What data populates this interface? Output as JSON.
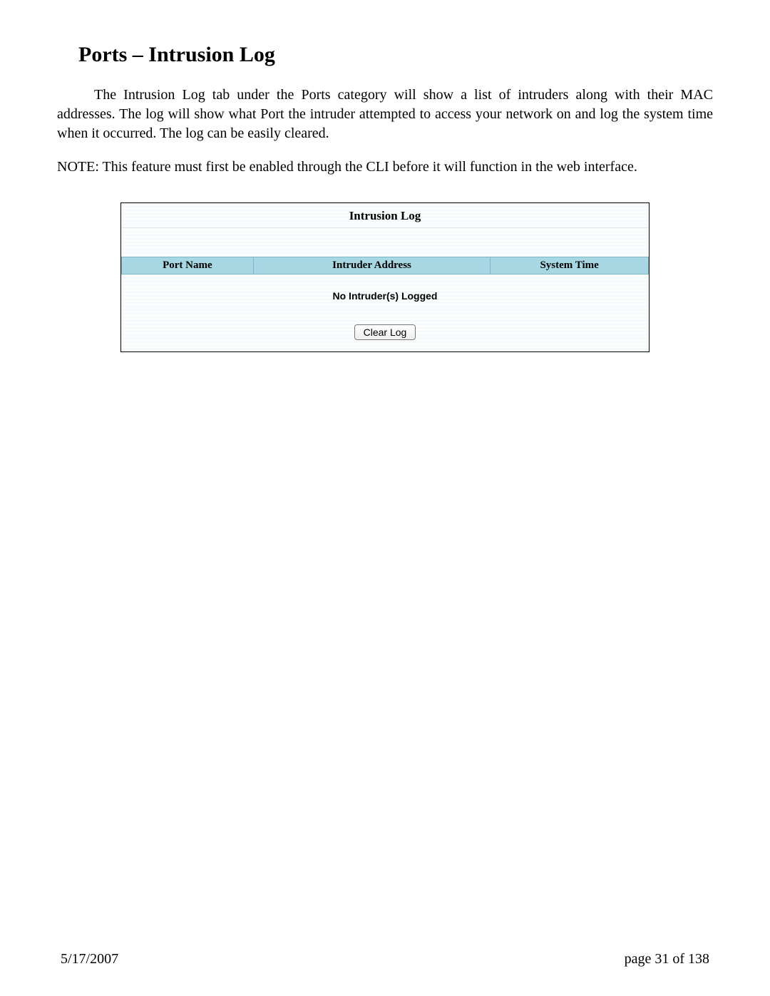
{
  "heading": "Ports – Intrusion Log",
  "paragraph1": "The Intrusion Log tab under the Ports category will show a list of intruders along with their MAC addresses.  The log will show what Port the intruder attempted to access your network on and log the system time when it occurred.  The log can be easily cleared.",
  "paragraph2": "NOTE: This feature must first be enabled through the CLI before it will function in the web interface.",
  "panel": {
    "title": "Intrusion Log",
    "columns": {
      "port": "Port Name",
      "addr": "Intruder Address",
      "time": "System Time"
    },
    "empty_message": "No Intruder(s) Logged",
    "clear_button": "Clear Log"
  },
  "footer": {
    "date": "5/17/2007",
    "page": "page 31 of 138"
  }
}
